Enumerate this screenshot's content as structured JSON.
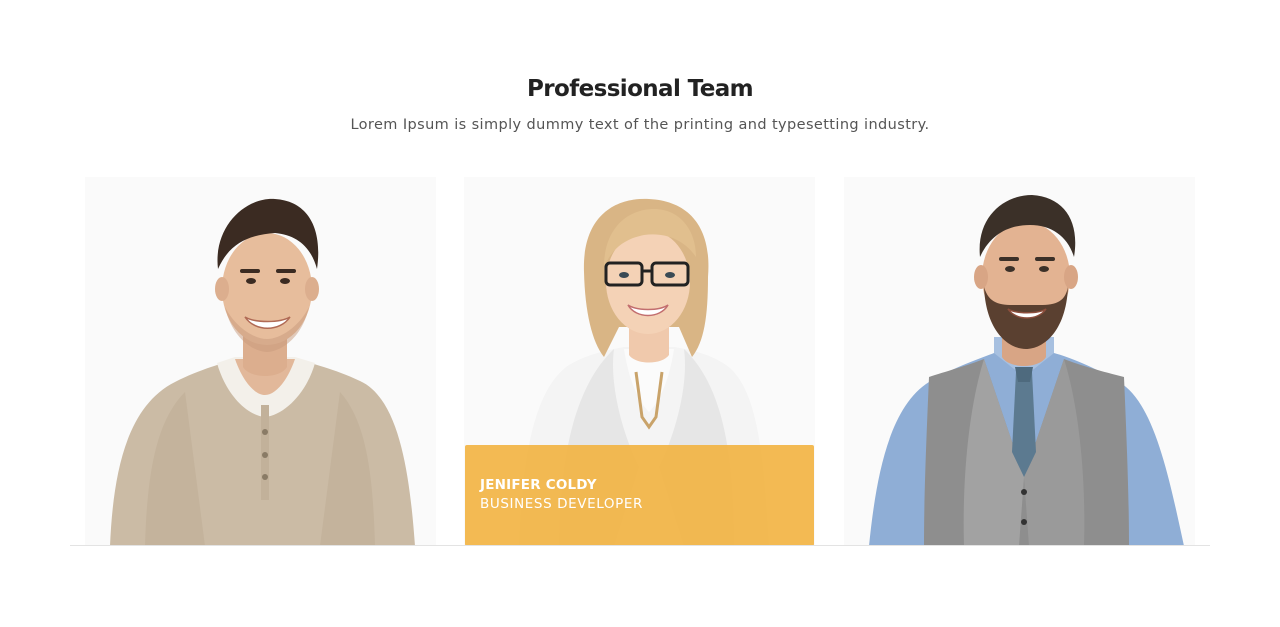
{
  "section": {
    "title": "Professional Team",
    "subtitle": "Lorem Ipsum is simply dummy text of the printing and typesetting industry."
  },
  "members": [
    {
      "photo": "man-beige-sweater-photo"
    },
    {
      "photo": "woman-white-blazer-photo",
      "name": "JENIFER COLDY",
      "role": "BUSINESS DEVELOPER"
    },
    {
      "photo": "man-grey-vest-photo"
    }
  ],
  "colors": {
    "overlay": "#f2b340",
    "title": "#222222",
    "subtitle": "#555555",
    "card_bg": "#fafafa"
  }
}
